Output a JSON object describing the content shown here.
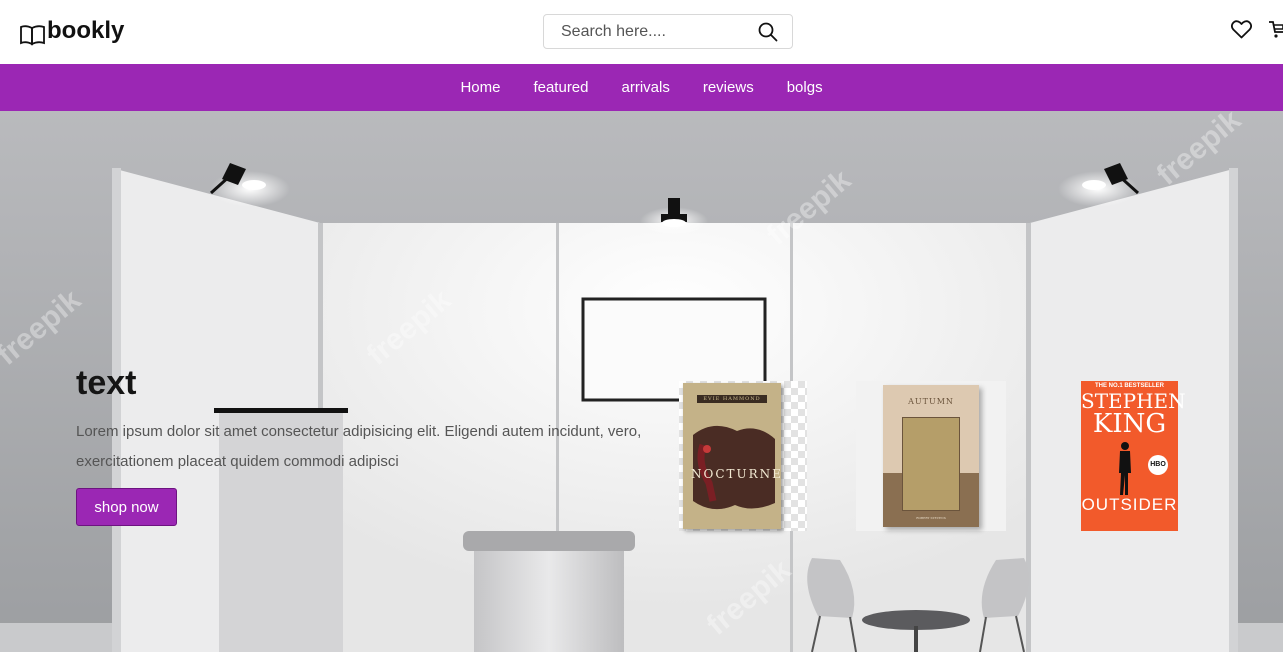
{
  "header": {
    "logo_text": "bookly",
    "search_placeholder": "Search here...."
  },
  "nav": {
    "items": [
      {
        "label": "Home"
      },
      {
        "label": "featured"
      },
      {
        "label": "arrivals"
      },
      {
        "label": "reviews"
      },
      {
        "label": "bolgs"
      }
    ]
  },
  "hero": {
    "title": "text",
    "description": "Lorem ipsum dolor sit amet consectetur adipisicing elit. Eligendi autem incidunt, vero, exercitationem placeat quidem commodi adipisci",
    "button_label": "shop now"
  },
  "books": [
    {
      "title": "NOCTURNE",
      "author": "EVIE HAMMOND"
    },
    {
      "title": "AUTUMN",
      "author": "ROBERT STEVENS"
    },
    {
      "tagline": "THE NO.1 BESTSELLER",
      "author_line1": "STEPHEN",
      "author_line2": "KING",
      "title": "OUTSIDER",
      "badge": "HBO"
    }
  ],
  "watermark": "freepik",
  "colors": {
    "accent": "#9b27b4",
    "book3_cover": "#f25a2b"
  },
  "icons": [
    "book-open-icon",
    "search-icon",
    "heart-icon",
    "cart-icon"
  ]
}
